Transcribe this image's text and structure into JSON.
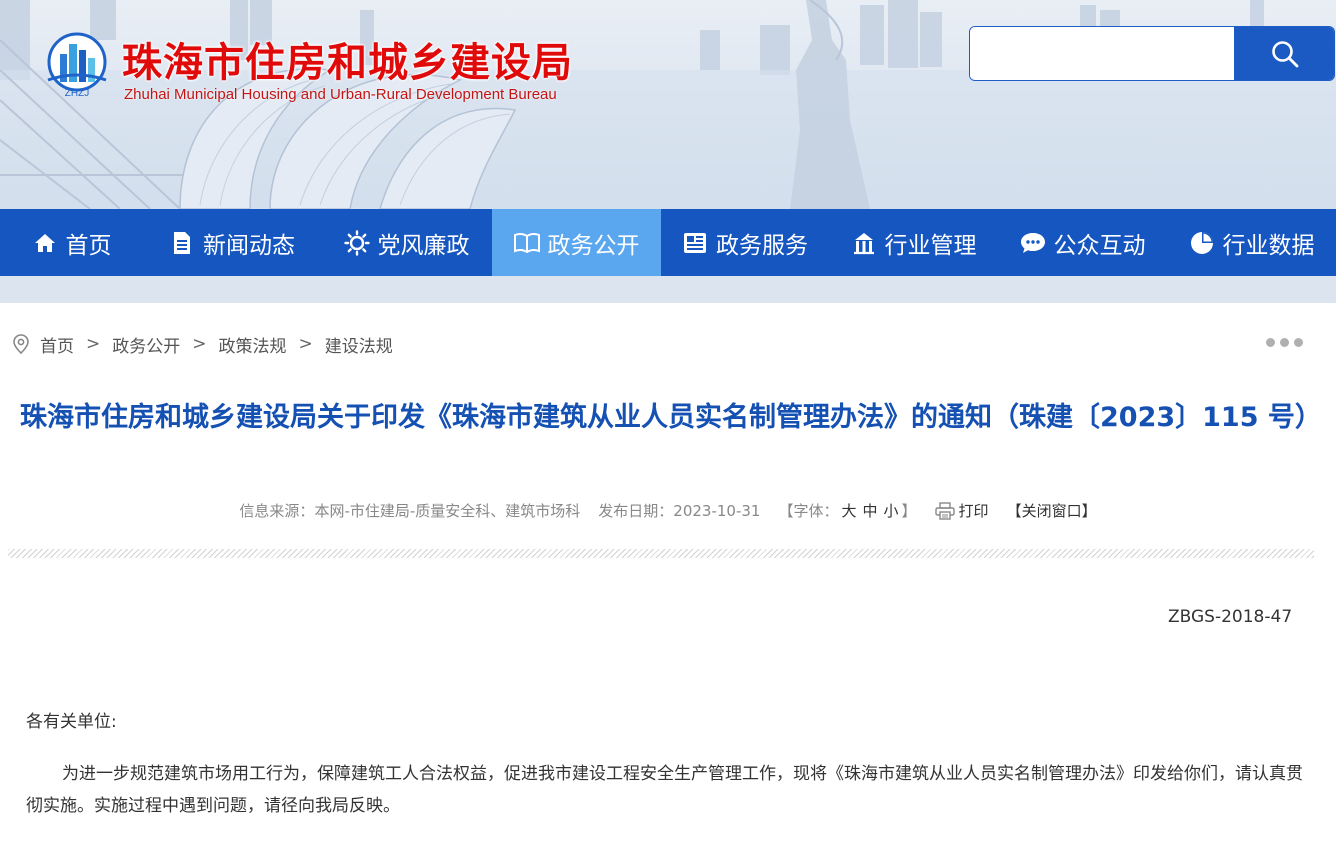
{
  "header": {
    "title": "珠海市住房和城乡建设局",
    "subtitle": "Zhuhai Municipal Housing and Urban-Rural Development Bureau",
    "logo_text": "ZHZJ",
    "search": {
      "placeholder": "",
      "value": "",
      "button_icon": "search-icon"
    }
  },
  "nav": {
    "items": [
      {
        "label": "首页",
        "icon": "home-icon"
      },
      {
        "label": "新闻动态",
        "icon": "document-icon"
      },
      {
        "label": "党风廉政",
        "icon": "sun-icon"
      },
      {
        "label": "政务公开",
        "icon": "open-book-icon",
        "active": true
      },
      {
        "label": "政务服务",
        "icon": "newspaper-icon"
      },
      {
        "label": "行业管理",
        "icon": "building-icon"
      },
      {
        "label": "公众互动",
        "icon": "chat-icon"
      },
      {
        "label": "行业数据",
        "icon": "pie-chart-icon"
      }
    ]
  },
  "breadcrumb": {
    "icon": "location-pin-icon",
    "items": [
      "首页",
      "政务公开",
      "政策法规",
      "建设法规"
    ],
    "separator": ">"
  },
  "article": {
    "title": "珠海市住房和城乡建设局关于印发《珠海市建筑从业人员实名制管理办法》的通知（珠建〔2023〕115 号）",
    "meta": {
      "source_label": "信息来源：",
      "source": "本网-市住建局-质量安全科、建筑市场科",
      "date_label": "发布日期：",
      "date": "2023-10-31",
      "font_label": "【字体：",
      "font_large": "大",
      "font_medium": "中",
      "font_small": "小",
      "font_close": "】",
      "print": "打印",
      "close_window": "【关闭窗口】"
    },
    "doc_number": "ZBGS-2018-47",
    "salutation": "各有关单位:",
    "body": "为进一步规范建筑市场用工行为，保障建筑工人合法权益，促进我市建设工程安全生产管理工作，现将《珠海市建筑从业人员实名制管理办法》印发给你们，请认真贯彻实施。实施过程中遇到问题，请径向我局反映。"
  },
  "colors": {
    "nav_bg": "#1556c0",
    "nav_active": "#5aa7ef",
    "title_blue": "#1550b3",
    "brand_red": "#e10a0a"
  }
}
